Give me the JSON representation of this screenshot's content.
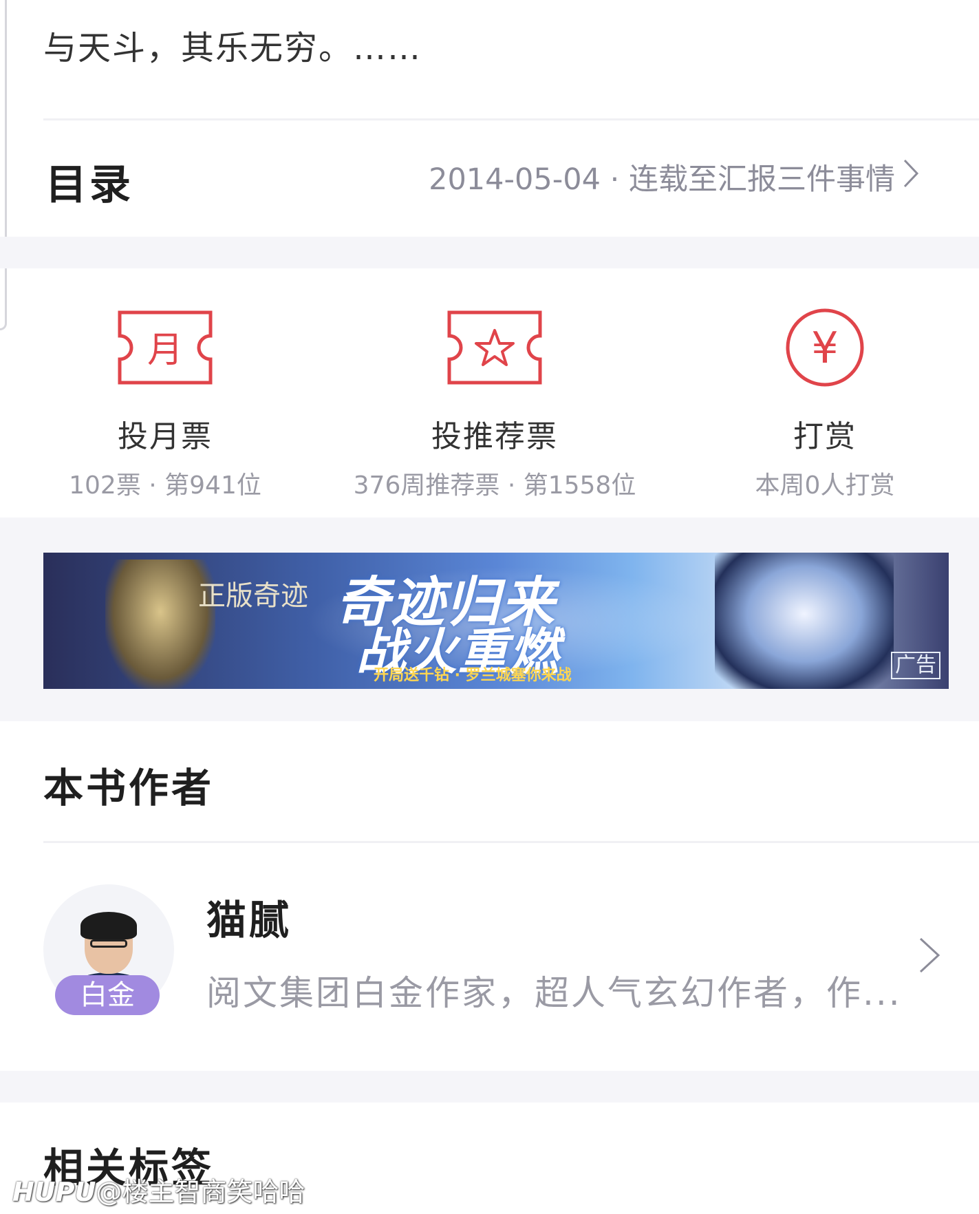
{
  "intro": {
    "text": "与天斗，其乐无穷。……"
  },
  "toc": {
    "title": "目录",
    "update_info": "2014-05-04 · 连载至汇报三件事情",
    "chevron_icon": "chevron-right-icon"
  },
  "actions": [
    {
      "label": "投月票",
      "sub": "102票 · 第941位",
      "icon": "monthly-ticket-icon",
      "icon_char": "月"
    },
    {
      "label": "投推荐票",
      "sub": "376周推荐票 · 第1558位",
      "icon": "recommend-ticket-icon"
    },
    {
      "label": "打赏",
      "sub": "本周0人打赏",
      "icon": "tip-yuan-icon",
      "icon_char": "¥"
    }
  ],
  "ad": {
    "brand": "正版奇迹",
    "headline_1": "奇迹归来",
    "headline_2": "战火重燃",
    "tagline": "开局送千钻 · 罗兰城塞你来战",
    "badge": "广告"
  },
  "author_section": {
    "title": "本书作者",
    "name": "猫腻",
    "badge": "白金",
    "description": "阅文集团白金作家，超人气玄幻作者，作..."
  },
  "tags_section": {
    "title": "相关标签"
  },
  "watermark": {
    "brand": "HUPU",
    "handle": "@楼主智商笑哈哈"
  },
  "colors": {
    "accent_red": "#e0444a",
    "muted_text": "#9a9aa4",
    "platinum": "#a18ae0",
    "band": "#f5f5f9"
  }
}
